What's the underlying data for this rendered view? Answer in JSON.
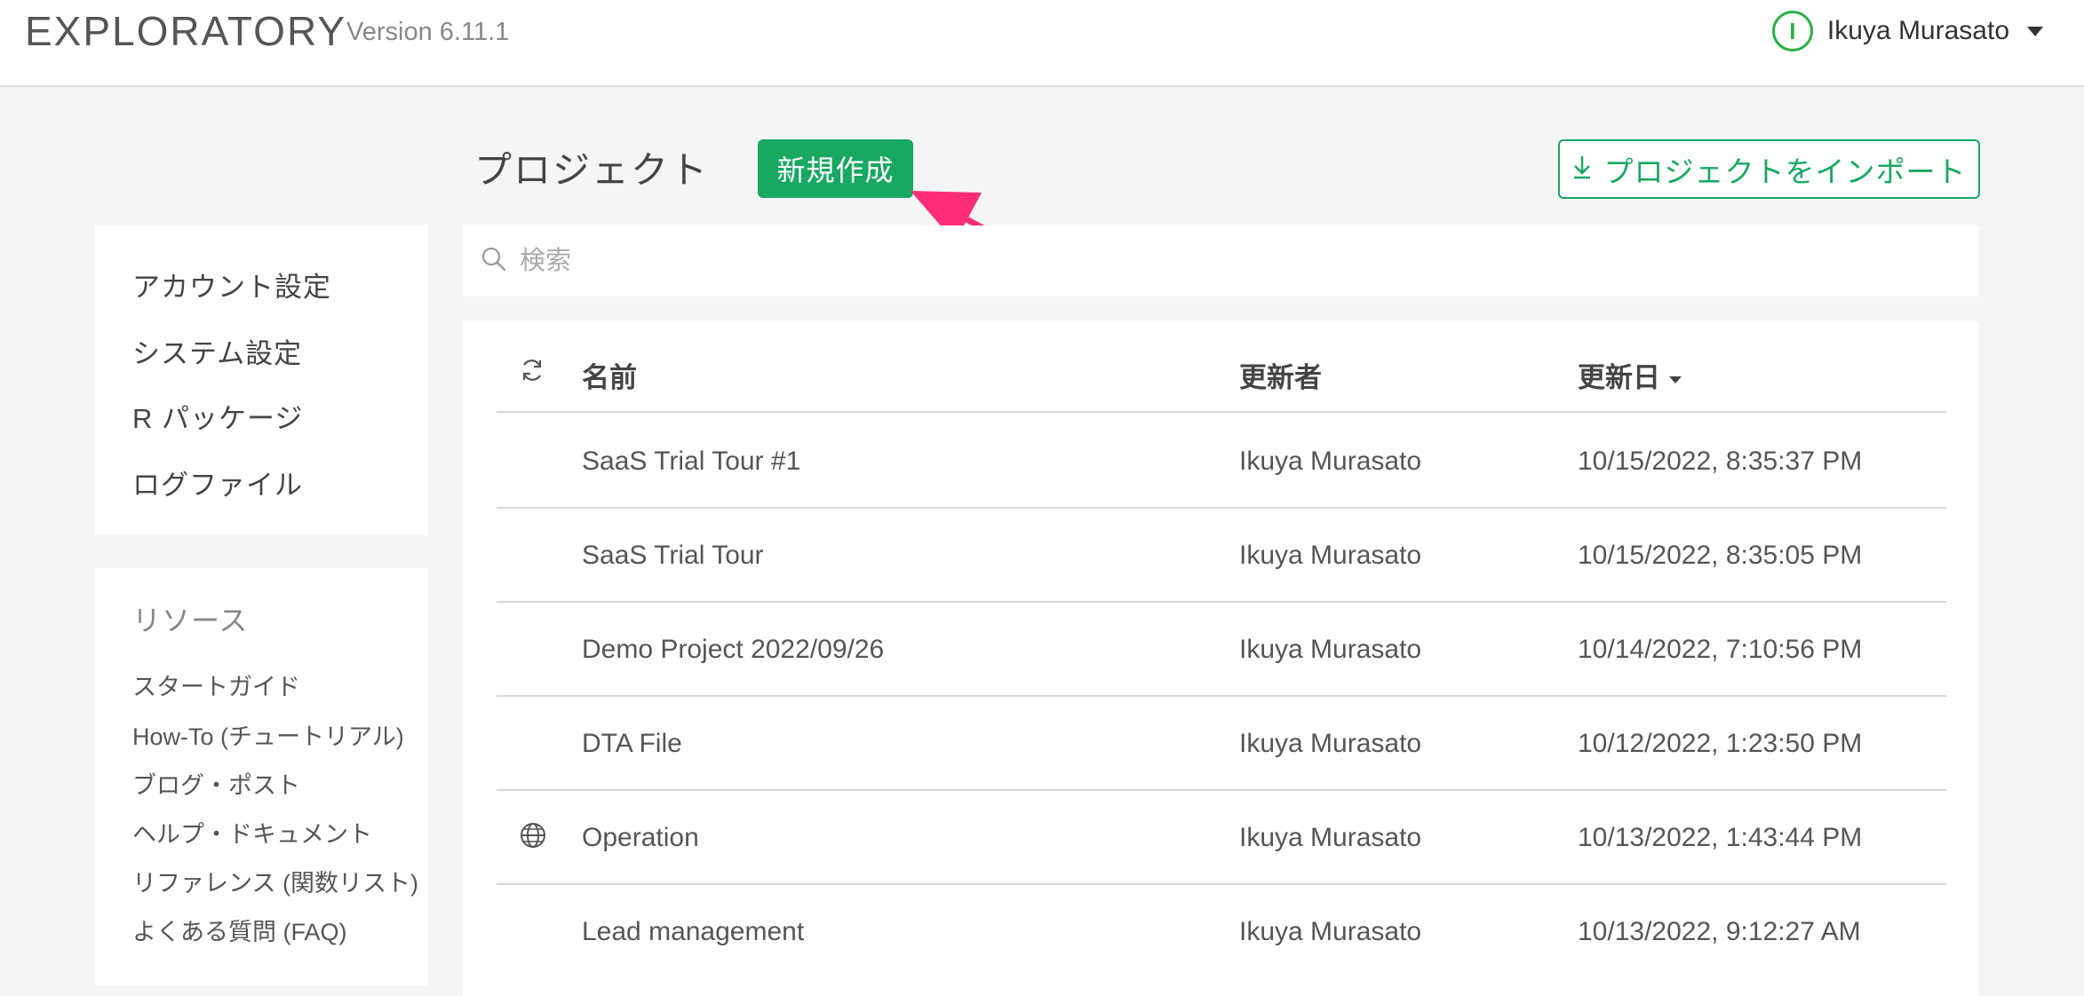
{
  "app": {
    "brand": "EXPLORATORY",
    "version": "Version 6.11.1"
  },
  "user": {
    "initial": "I",
    "name": "Ikuya Murasato"
  },
  "page": {
    "title": "プロジェクト",
    "new_button": "新規作成",
    "import_button": "プロジェクトをインポート"
  },
  "search": {
    "placeholder": "検索"
  },
  "sidebar": {
    "items": [
      "アカウント設定",
      "システム設定",
      "R パッケージ",
      "ログファイル"
    ]
  },
  "resources": {
    "title": "リソース",
    "items": [
      "スタートガイド",
      "How-To (チュートリアル)",
      "ブログ・ポスト",
      "ヘルプ・ドキュメント",
      "リファレンス (関数リスト)",
      "よくある質問 (FAQ)"
    ]
  },
  "table": {
    "headers": {
      "name": "名前",
      "updated_by": "更新者",
      "updated_at": "更新日"
    },
    "rows": [
      {
        "name": "SaaS Trial Tour #1",
        "updated_by": "Ikuya Murasato",
        "updated_at": "10/15/2022, 8:35:37 PM",
        "icon": ""
      },
      {
        "name": "SaaS Trial Tour",
        "updated_by": "Ikuya Murasato",
        "updated_at": "10/15/2022, 8:35:05 PM",
        "icon": ""
      },
      {
        "name": "Demo Project 2022/09/26",
        "updated_by": "Ikuya Murasato",
        "updated_at": "10/14/2022, 7:10:56 PM",
        "icon": ""
      },
      {
        "name": "DTA File",
        "updated_by": "Ikuya Murasato",
        "updated_at": "10/12/2022, 1:23:50 PM",
        "icon": ""
      },
      {
        "name": "Operation",
        "updated_by": "Ikuya Murasato",
        "updated_at": "10/13/2022, 1:43:44 PM",
        "icon": "globe-icon"
      },
      {
        "name": "Lead management",
        "updated_by": "Ikuya Murasato",
        "updated_at": "10/13/2022, 9:12:27 AM",
        "icon": ""
      }
    ]
  },
  "colors": {
    "accent": "#18a862",
    "avatar": "#2bb04a",
    "arrow": "#ff2d78"
  }
}
